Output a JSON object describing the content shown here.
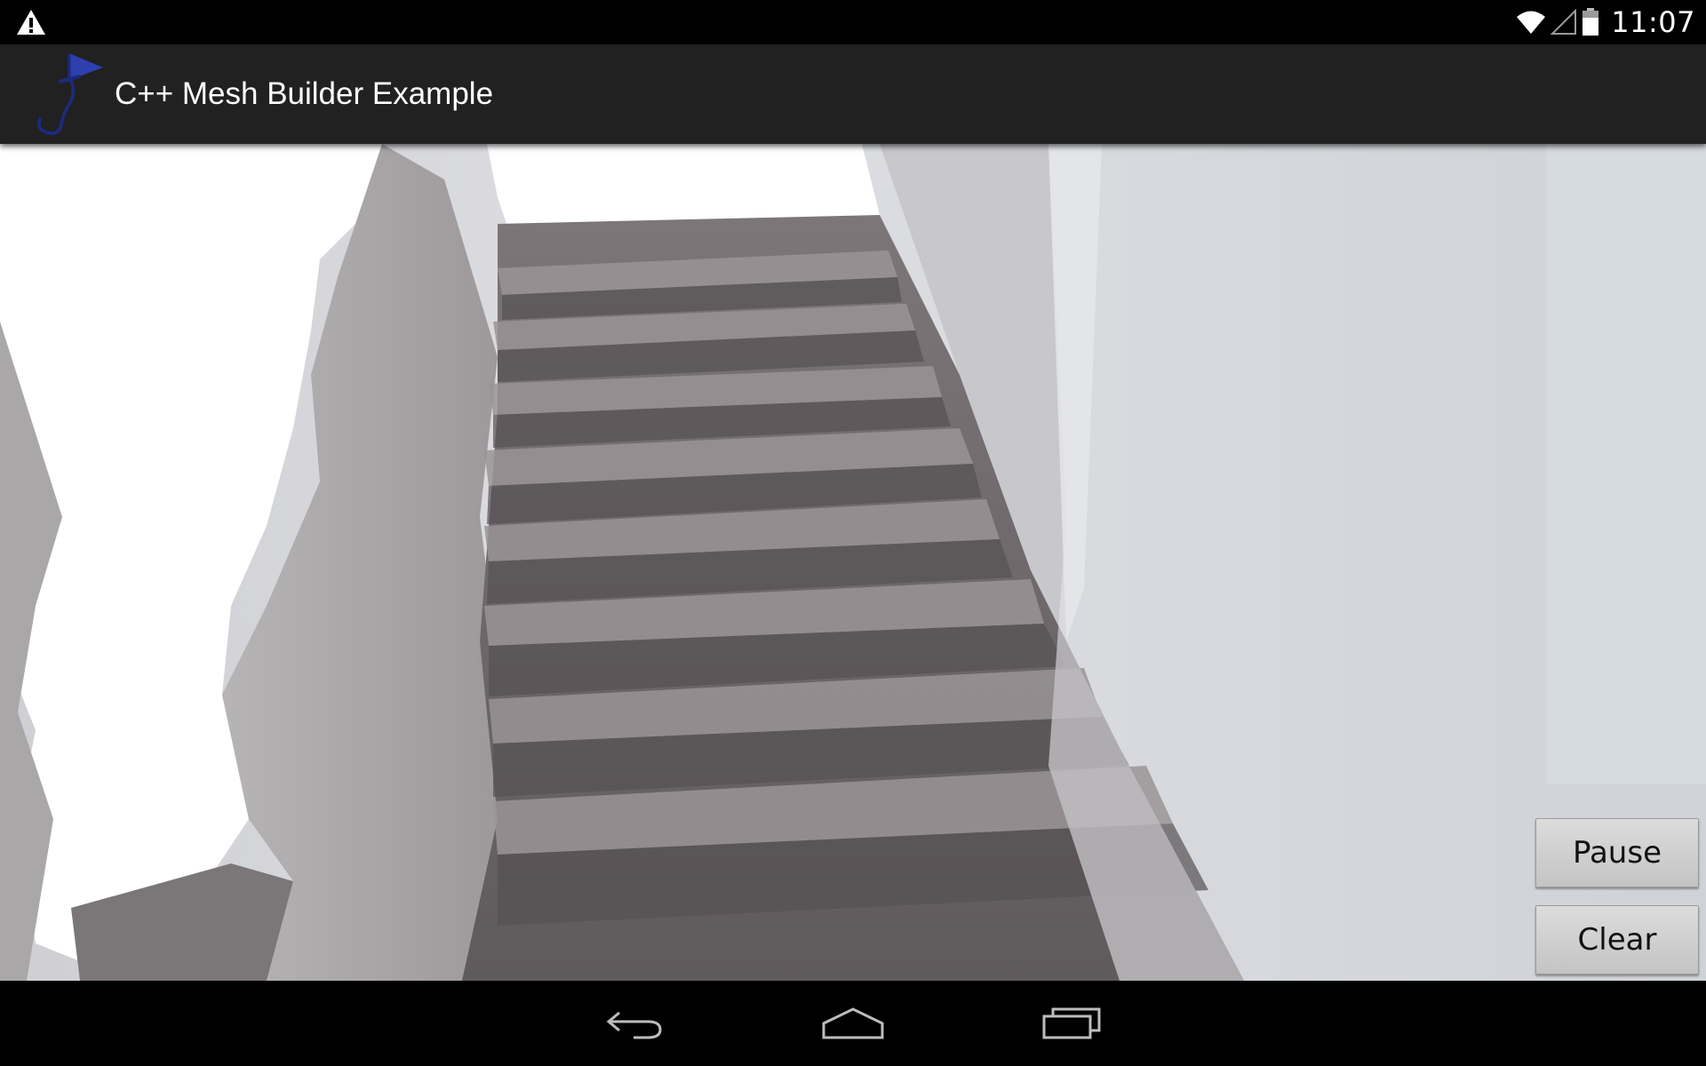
{
  "status_bar": {
    "time": "11:07",
    "icons": [
      "warning-icon",
      "wifi-icon",
      "cell-signal-icon",
      "battery-icon"
    ]
  },
  "action_bar": {
    "app_icon": "tango-flag-icon",
    "title": "C++ Mesh Builder Example"
  },
  "viewport": {
    "content": "3d-mesh-reconstruction-of-staircase"
  },
  "controls": {
    "pause_label": "Pause",
    "clear_label": "Clear"
  },
  "nav_bar": {
    "icons": [
      "back-icon",
      "home-icon",
      "recents-icon"
    ]
  },
  "colors": {
    "action_bar_bg": "#212121",
    "status_bar_bg": "#000000",
    "icon_accent": "#2e3fb0"
  }
}
